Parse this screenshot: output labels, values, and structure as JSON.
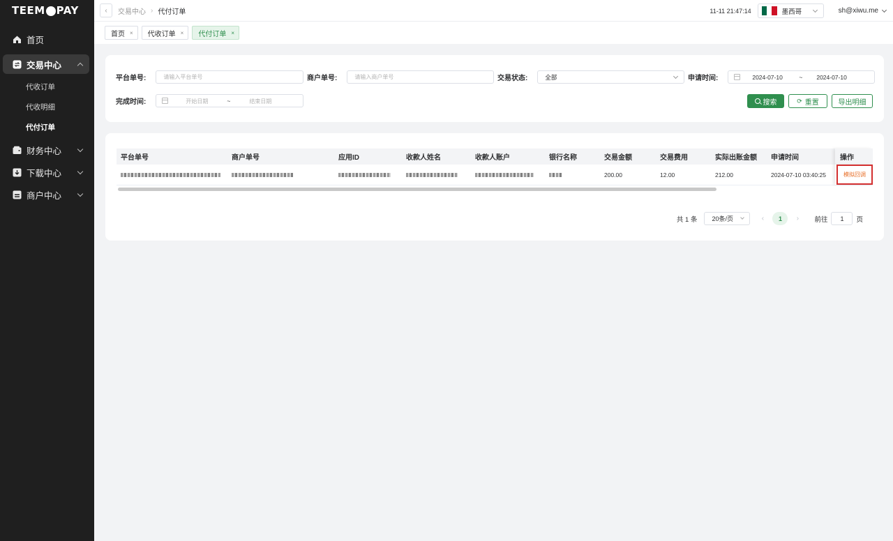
{
  "app": {
    "logo_text_left": "TEEM",
    "logo_text_right": "PAY"
  },
  "sidebar": {
    "items": [
      {
        "label": "首页",
        "icon": "home-icon"
      },
      {
        "label": "交易中心",
        "icon": "exchange-icon",
        "expanded": true,
        "children": [
          {
            "label": "代收订单"
          },
          {
            "label": "代收明细"
          },
          {
            "label": "代付订单",
            "current": true
          }
        ]
      },
      {
        "label": "财务中心",
        "icon": "wallet-icon"
      },
      {
        "label": "下载中心",
        "icon": "download-icon"
      },
      {
        "label": "商户中心",
        "icon": "merchant-icon"
      }
    ]
  },
  "header": {
    "back_icon": "chevron-left-icon",
    "breadcrumb": [
      "交易中心",
      "代付订单"
    ],
    "time": "11-11 21:47:14",
    "country": {
      "name": "墨西哥",
      "flag_colors": [
        "#006847",
        "#ffffff",
        "#ce1126"
      ]
    },
    "user": "sh@xiwu.me"
  },
  "tags": [
    {
      "label": "首页",
      "close": "×"
    },
    {
      "label": "代收订单",
      "close": "×"
    },
    {
      "label": "代付订单",
      "close": "×",
      "active": true
    }
  ],
  "filters": {
    "platform_no": {
      "label": "平台单号:",
      "placeholder": "请输入平台单号"
    },
    "merchant_no": {
      "label": "商户单号:",
      "placeholder": "请输入商户单号"
    },
    "status": {
      "label": "交易状态:",
      "value": "全部"
    },
    "apply_time": {
      "label": "申请时间:",
      "start": "2024-07-10",
      "separator": "~",
      "end": "2024-07-10"
    },
    "finish_time": {
      "label": "完成时间:",
      "start_placeholder": "开始日期",
      "separator": "~",
      "end_placeholder": "结束日期"
    },
    "buttons": {
      "search": "搜索",
      "reset": "重置",
      "export": "导出明细"
    }
  },
  "table": {
    "columns": [
      "平台单号",
      "商户单号",
      "应用ID",
      "收款人姓名",
      "收款人账户",
      "银行名称",
      "交易金额",
      "交易费用",
      "实际出账金额",
      "申请时间",
      "操作"
    ],
    "rows": [
      {
        "amount": "200.00",
        "fee": "12.00",
        "actual": "212.00",
        "apply_time": "2024-07-10 03:40:25",
        "action": "模拟回调"
      }
    ]
  },
  "pagination": {
    "total_text": "共 1 条",
    "page_size": "20条/页",
    "current_page": "1",
    "goto_label": "前往",
    "goto_value": "1",
    "page_suffix": "页"
  },
  "colors": {
    "brand": "#2f8f4e",
    "sidebar_bg": "#1f1f1f",
    "highlight_border": "#d32f2f",
    "action_link": "#e8702a"
  }
}
